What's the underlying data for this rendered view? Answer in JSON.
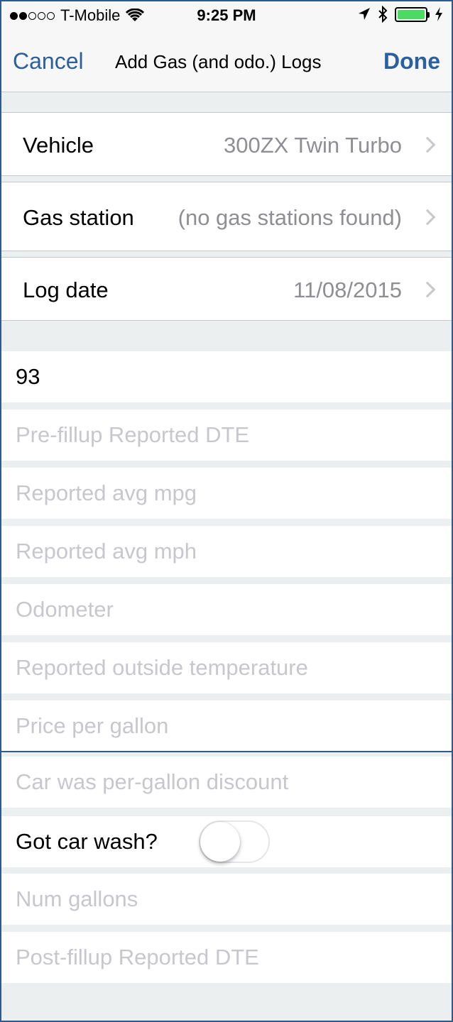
{
  "status_bar": {
    "carrier": "T-Mobile",
    "time": "9:25 PM",
    "signal_dots_filled": 2,
    "signal_dots_total": 5,
    "battery_fraction": 1.0,
    "battery_color": "#4cd964",
    "icons": [
      "wifi-icon",
      "location-arrow-icon",
      "bluetooth-icon",
      "battery-icon",
      "charging-bolt-icon"
    ]
  },
  "nav": {
    "cancel_label": "Cancel",
    "title": "Add Gas (and odo.) Logs",
    "done_label": "Done",
    "accent_color": "#2a5fa0"
  },
  "rows": {
    "vehicle": {
      "label": "Vehicle",
      "value": "300ZX Twin Turbo"
    },
    "gas_station": {
      "label": "Gas station",
      "value": "(no gas stations found)"
    },
    "log_date": {
      "label": "Log date",
      "value": "11/08/2015"
    }
  },
  "fields": {
    "octane": {
      "value": "93"
    },
    "pre_dte": {
      "placeholder": "Pre-fillup Reported DTE"
    },
    "avg_mpg": {
      "placeholder": "Reported avg mpg"
    },
    "avg_mph": {
      "placeholder": "Reported avg mph"
    },
    "odometer": {
      "placeholder": "Odometer"
    },
    "outside_temp": {
      "placeholder": "Reported outside temperature"
    },
    "price_per_gallon": {
      "placeholder": "Price per gallon"
    },
    "discount": {
      "placeholder": "Car was per-gallon discount"
    },
    "car_wash": {
      "label": "Got car wash?",
      "on": false
    },
    "num_gallons": {
      "placeholder": "Num gallons"
    },
    "post_dte": {
      "placeholder": "Post-fillup Reported DTE"
    }
  }
}
